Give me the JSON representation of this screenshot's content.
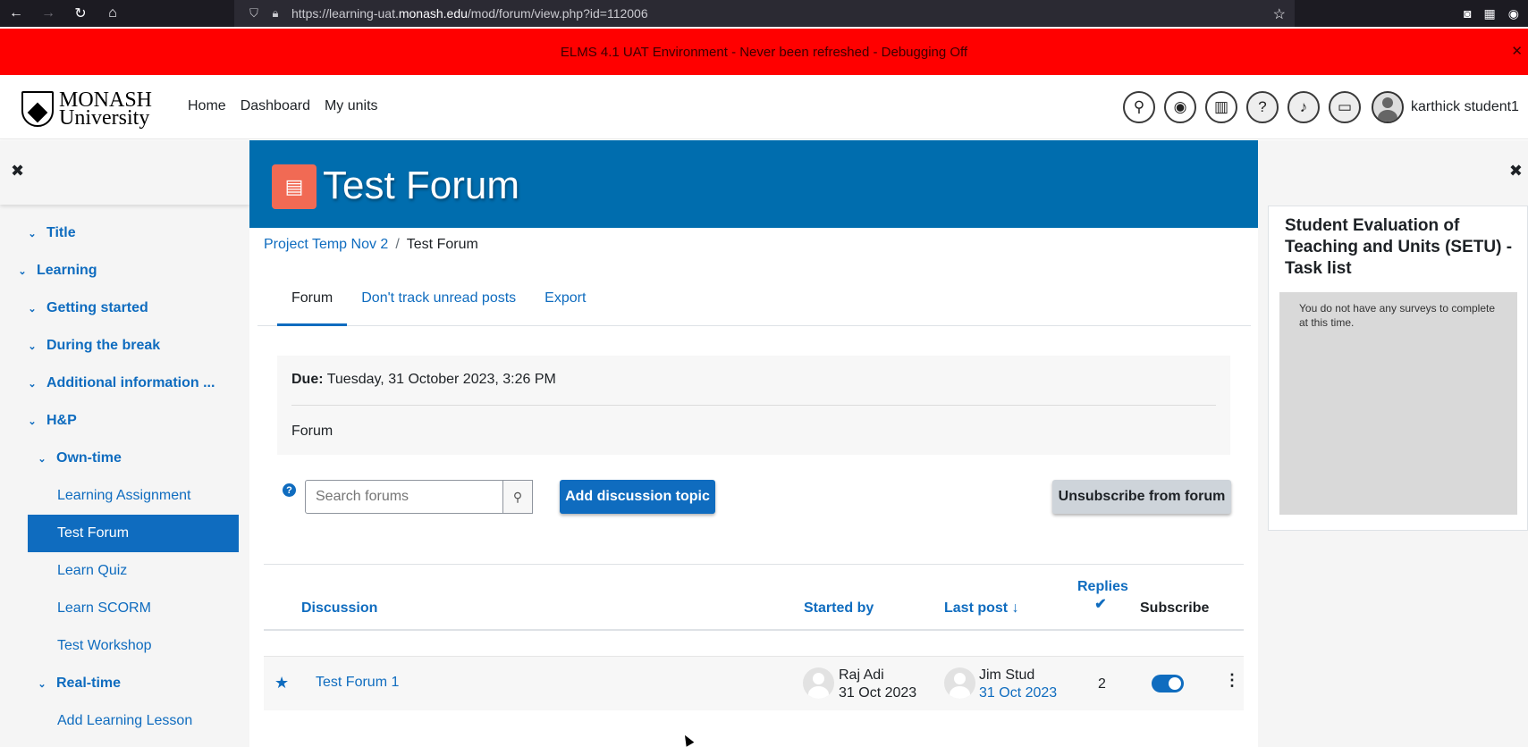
{
  "browser": {
    "url_prefix": "https://learning-uat.",
    "url_host": "monash.edu",
    "url_path": "/mod/forum/view.php?id=112006"
  },
  "env_banner": {
    "text": "ELMS 4.1 UAT Environment - Never been refreshed - Debugging Off",
    "close": "✕"
  },
  "header": {
    "logo_line1": "MONASH",
    "logo_line2": "University",
    "nav": [
      "Home",
      "Dashboard",
      "My units"
    ],
    "user_name": "karthick student1"
  },
  "course_index": [
    {
      "label": "Title",
      "section": true
    },
    {
      "label": "Learning",
      "section": true
    },
    {
      "label": "Getting started",
      "section": true
    },
    {
      "label": "During the break",
      "section": true
    },
    {
      "label": "Additional information ...",
      "section": true
    },
    {
      "label": "H&P",
      "section": true
    },
    {
      "label": "Own-time",
      "section": true
    },
    {
      "label": "Learning Assignment",
      "section": false
    },
    {
      "label": "Test Forum",
      "section": false,
      "active": true
    },
    {
      "label": "Learn Quiz",
      "section": false
    },
    {
      "label": "Learn SCORM",
      "section": false
    },
    {
      "label": "Test Workshop",
      "section": false
    },
    {
      "label": "Real-time",
      "section": true
    },
    {
      "label": "Add Learning Lesson",
      "section": false
    }
  ],
  "page": {
    "title": "Test Forum",
    "breadcrumb": [
      "Project Temp Nov 2",
      "/",
      "Test Forum"
    ],
    "tabs": [
      "Forum",
      "Don't track unread posts",
      "Export"
    ],
    "due_label": "Due:",
    "due_value": "Tuesday, 31 October 2023, 3:26 PM",
    "description": "Forum",
    "search_placeholder": "Search forums",
    "add_button": "Add discussion topic",
    "unsubscribe_button": "Unsubscribe from forum"
  },
  "table": {
    "headers": {
      "discussion": "Discussion",
      "started_by": "Started by",
      "last_post": "Last post",
      "replies": "Replies",
      "subscribe": "Subscribe"
    },
    "rows": [
      {
        "discussion": "Test Forum 1",
        "started_by_name": "Raj Adi",
        "started_by_date": "31 Oct 2023",
        "last_post_name": "Jim Stud",
        "last_post_date": "31 Oct 2023",
        "replies": "2",
        "subscribed": true
      }
    ]
  },
  "right_block": {
    "title": "Student Evaluation of Teaching and Units (SETU) - Task list",
    "body": "You do not have any surveys to complete at this time."
  },
  "colors": {
    "brand_blue": "#006dae",
    "link_blue": "#0f6cbf",
    "banner_red": "#ff0000",
    "forum_icon": "#f16a54"
  }
}
